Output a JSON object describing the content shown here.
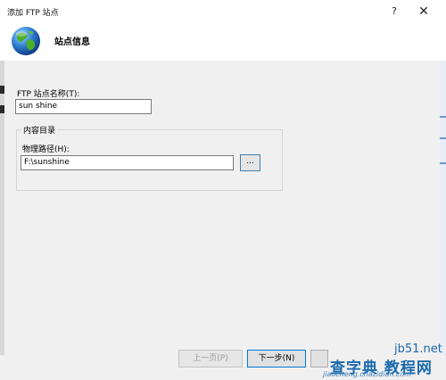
{
  "window": {
    "title": "添加 FTP 站点",
    "help_glyph": "?",
    "close_glyph": "✕"
  },
  "header": {
    "title": "站点信息",
    "icon": "globe-icon"
  },
  "form": {
    "site_name_label": "FTP 站点名称(T):",
    "site_name_value": "sun shine",
    "content_dir_legend": "内容目录",
    "physical_path_label": "物理路径(H):",
    "physical_path_value": "F:\\sunshine",
    "browse_label": "..."
  },
  "buttons": {
    "prev_label": "上一页(P)",
    "next_label": "下一步(N)"
  },
  "watermark": {
    "line1": "jb51.net",
    "line2": "查字典 教程网",
    "line3": "jiaocheng.chazidian.com"
  },
  "colors": {
    "accent": "#0078d7",
    "watermark": "#1c6aad"
  }
}
